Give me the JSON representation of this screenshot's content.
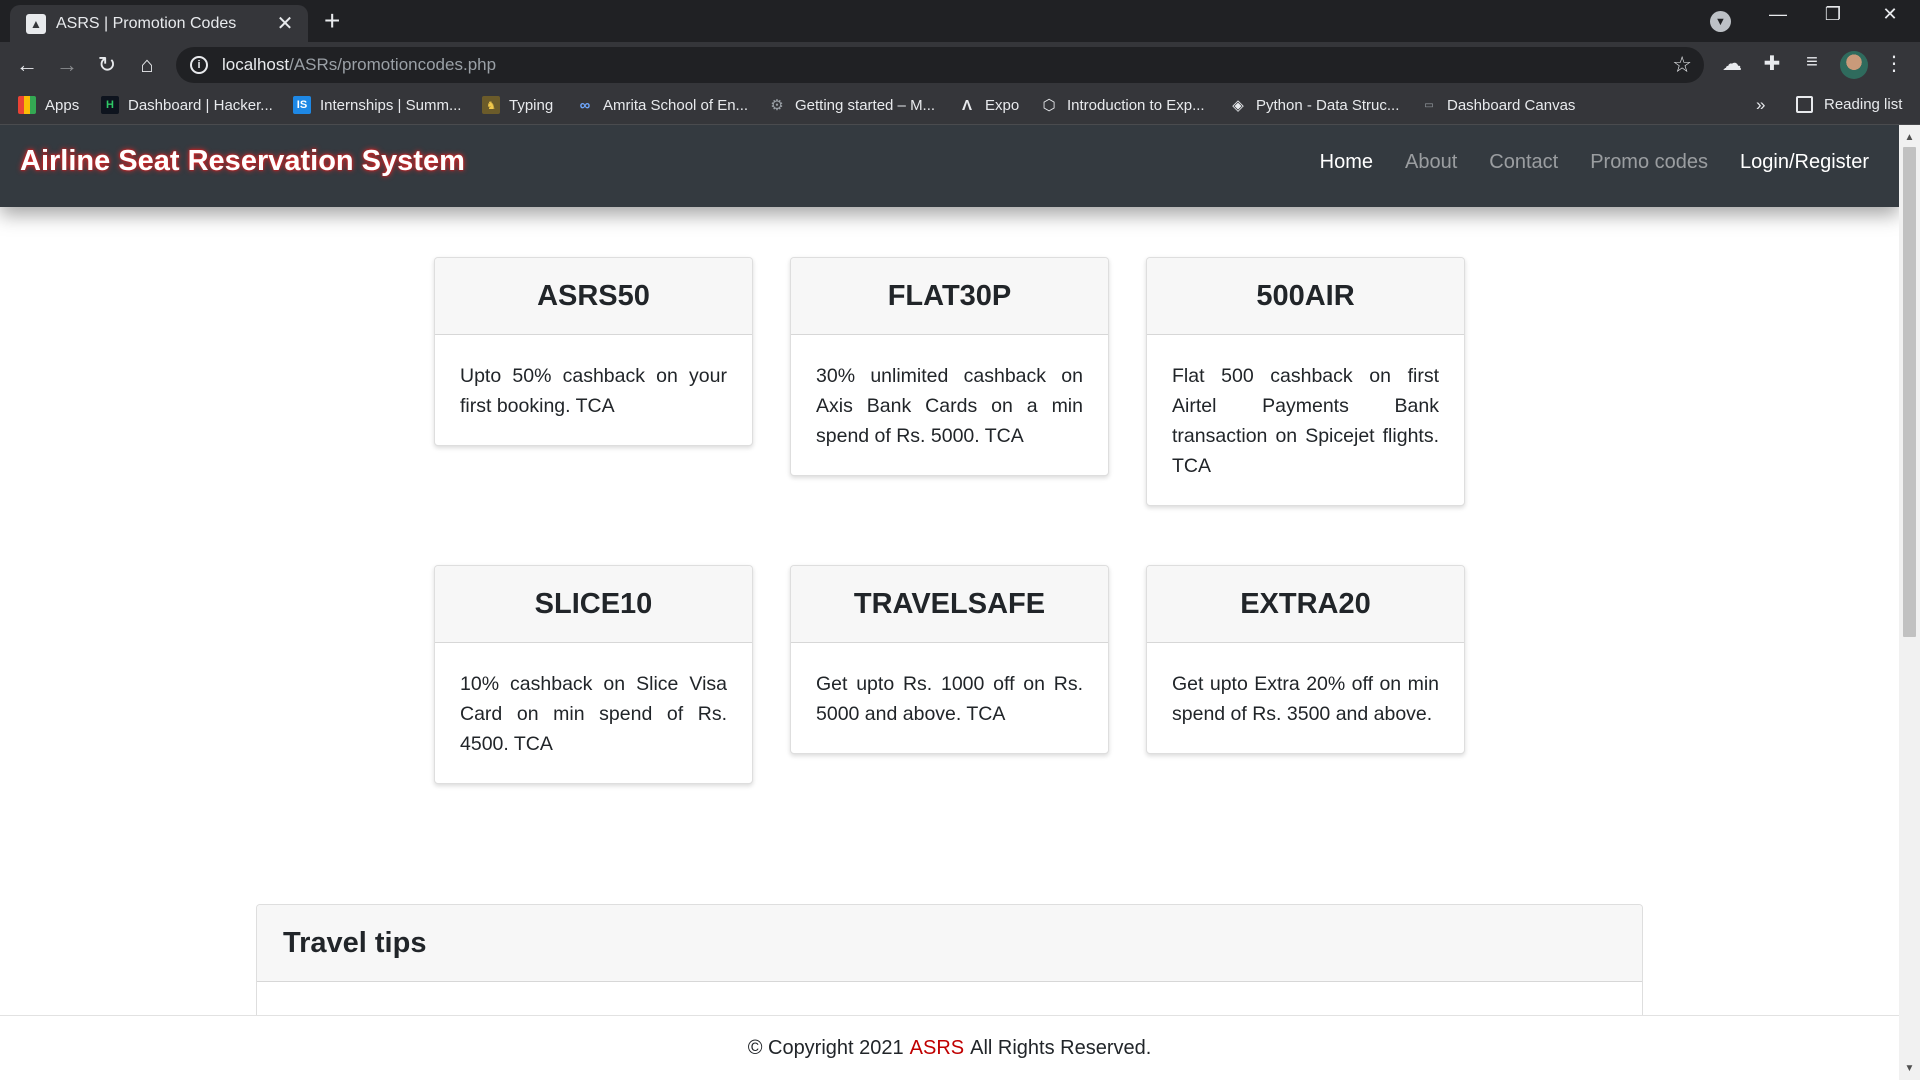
{
  "browser": {
    "tab_title": "ASRS | Promotion Codes",
    "url_host": "localhost",
    "url_path": "/ASRs/promotioncodes.php",
    "bookmarks": [
      {
        "label": "Apps",
        "icon": "apps-grid-icon"
      },
      {
        "label": "Dashboard | Hacker...",
        "icon": "hackerrank-icon"
      },
      {
        "label": "Internships | Summ...",
        "icon": "internshala-icon"
      },
      {
        "label": "Typing",
        "icon": "typing-icon"
      },
      {
        "label": "Amrita School of En...",
        "icon": "amrita-icon"
      },
      {
        "label": "Getting started – M...",
        "icon": "gear-icon"
      },
      {
        "label": "Expo",
        "icon": "expo-icon"
      },
      {
        "label": "Introduction to Exp...",
        "icon": "expo-docs-icon"
      },
      {
        "label": "Python - Data Struc...",
        "icon": "python-icon"
      },
      {
        "label": "Dashboard Canvas",
        "icon": "canvas-icon"
      }
    ],
    "reading_list": "Reading list"
  },
  "site": {
    "brand": "Airline Seat Reservation System",
    "nav": [
      "Home",
      "About",
      "Contact",
      "Promo codes",
      "Login/Register"
    ]
  },
  "promo_cards": [
    {
      "code": "ASRS50",
      "desc": "Upto 50% cashback on your first booking. TCA"
    },
    {
      "code": "FLAT30P",
      "desc": "30% unlimited cashback on Axis Bank Cards on a min spend of Rs. 5000. TCA"
    },
    {
      "code": "500AIR",
      "desc": "Flat 500 cashback on first Airtel Payments Bank transaction on Spicejet flights. TCA"
    },
    {
      "code": "SLICE10",
      "desc": "10% cashback on Slice Visa Card on min spend of Rs. 4500. TCA"
    },
    {
      "code": "TRAVELSAFE",
      "desc": "Get upto Rs. 1000 off on Rs. 5000 and above. TCA"
    },
    {
      "code": "EXTRA20",
      "desc": "Get upto Extra 20% off on min spend of Rs. 3500 and above."
    }
  ],
  "tips": {
    "title": "Travel tips"
  },
  "footer": {
    "prefix": "© Copyright 2021",
    "brand": "ASRS",
    "suffix": "All Rights Reserved."
  },
  "colors": {
    "navbar": "#343a40",
    "footer_brand": "#c00000",
    "brand_glow": "#ff2828"
  }
}
